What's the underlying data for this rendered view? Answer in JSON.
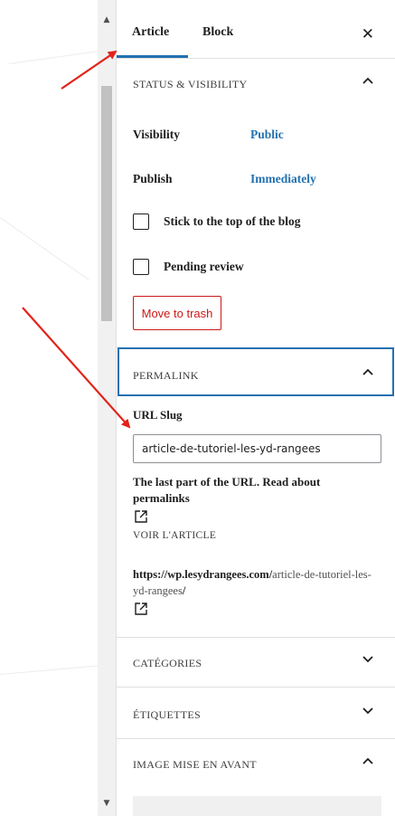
{
  "tabs": {
    "article": "Article",
    "block": "Block"
  },
  "status_visibility": {
    "title": "STATUS & VISIBILITY",
    "visibility_label": "Visibility",
    "visibility_value": "Public",
    "publish_label": "Publish",
    "publish_value": "Immediately",
    "sticky_label": "Stick to the top of the blog",
    "pending_label": "Pending review",
    "trash_label": "Move to trash"
  },
  "permalink": {
    "title": "PERMALINK",
    "url_slug_label": "URL Slug",
    "url_slug_value": "article-de-tutoriel-les-yd-rangees",
    "help_text": "The last part of the URL. Read about permalinks",
    "view_label": "VOIR L'ARTICLE",
    "url_host": "https://wp.lesydrangees.com/",
    "url_slug": "article-de-tutoriel-les-yd-rangees",
    "url_trail": "/"
  },
  "categories": {
    "title": "CATÉGORIES"
  },
  "tags": {
    "title": "ÉTIQUETTES"
  },
  "featured_image": {
    "title": "IMAGE MISE EN AVANT"
  },
  "colors": {
    "accent": "#2271b1",
    "danger": "#cc1818",
    "annotation": "#e2231a"
  },
  "icons": {
    "close": "close-icon",
    "collapse": "chevron-up-icon",
    "expand": "chevron-down-icon",
    "external": "external-link-icon"
  }
}
